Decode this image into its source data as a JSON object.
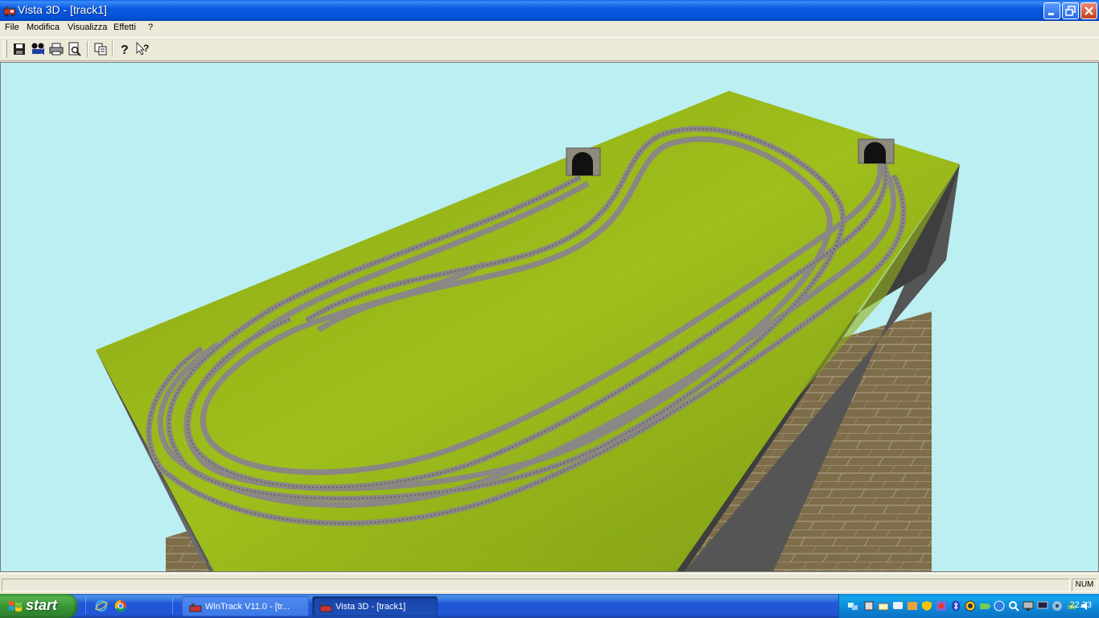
{
  "window": {
    "title": "Vista 3D - [track1]"
  },
  "menu": {
    "items": [
      "File",
      "Modifica",
      "Visualizza",
      "Effetti",
      "?"
    ]
  },
  "toolbar": {
    "tools": [
      "save-icon",
      "camera-icon",
      "print-icon",
      "print-preview-icon",
      "copy-icon",
      "help-icon",
      "context-help-icon"
    ]
  },
  "status": {
    "main_text": "",
    "num": "NUM"
  },
  "taskbar": {
    "start_label": "start",
    "tasks": [
      {
        "label": "WinTrack  V11.0 - [tr..."
      },
      {
        "label": "Vista 3D - [track1]"
      }
    ],
    "clock": "22.33"
  },
  "colors": {
    "sky": "#bbeff2",
    "grass": "#8fae1a",
    "board_side": "#6a6a6a",
    "floor": "#7a6a48",
    "track": "#8a8784"
  }
}
